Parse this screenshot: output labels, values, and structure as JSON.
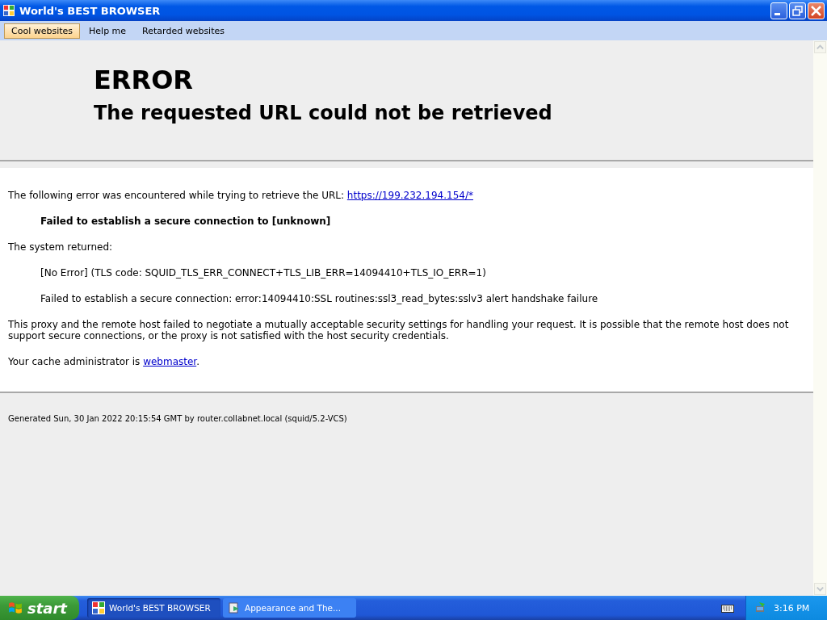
{
  "window": {
    "title": "World's BEST BROWSER"
  },
  "menu": [
    {
      "label": "Cool websites",
      "selected": true
    },
    {
      "label": "Help me",
      "selected": false
    },
    {
      "label": "Retarded websites",
      "selected": false
    }
  ],
  "page": {
    "heading": "ERROR",
    "subheading": "The requested URL could not be retrieved",
    "intro": {
      "text": "The following error was encountered while trying to retrieve the URL: ",
      "link": "https://199.232.194.154/*"
    },
    "error_title": "Failed to establish a secure connection to [unknown]",
    "system_label": "The system returned:",
    "details": [
      "[No Error] (TLS code: SQUID_TLS_ERR_CONNECT+TLS_LIB_ERR=14094410+TLS_IO_ERR=1)",
      "Failed to establish a secure connection: error:14094410:SSL routines:ssl3_read_bytes:sslv3 alert handshake failure"
    ],
    "explanation": "This proxy and the remote host failed to negotiate a mutually acceptable security settings for handling your request. It is possible that the remote host does not support secure connections, or the proxy is not satisfied with the host security credentials.",
    "admin": {
      "text": "Your cache administrator is ",
      "link": "webmaster",
      "after": "."
    },
    "footer": "Generated Sun, 30 Jan 2022 20:15:54 GMT by router.collabnet.local (squid/5.2-VCS)"
  },
  "taskbar": {
    "start": "start",
    "tasks": [
      {
        "label": "World's BEST BROWSER",
        "selected": true
      },
      {
        "label": "Appearance and The...",
        "selected": false
      }
    ],
    "clock": "3:16 PM"
  }
}
